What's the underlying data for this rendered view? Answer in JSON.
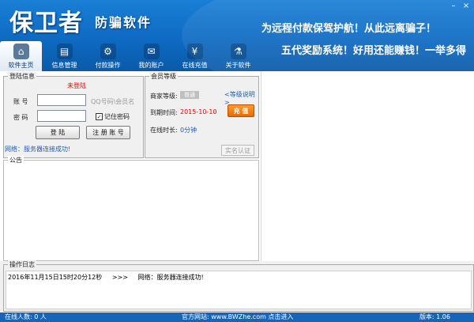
{
  "header": {
    "logo_main": "保卫者",
    "logo_sub": "防骗软件",
    "slogan_1": "为远程付款保驾护航！从此远离骗子！",
    "slogan_2": "五代奖励系统！好用还能赚钱！一举多得",
    "window_buttons": {
      "minimize": "–",
      "close": "×"
    }
  },
  "tabs": [
    {
      "label": "软件主页",
      "icon": "home-icon",
      "glyph": "⌂",
      "active": true
    },
    {
      "label": "信息管理",
      "icon": "document-icon",
      "glyph": "▤",
      "active": false
    },
    {
      "label": "付款操作",
      "icon": "gear-icon",
      "glyph": "⚙",
      "active": false
    },
    {
      "label": "我的账户",
      "icon": "mail-icon",
      "glyph": "✉",
      "active": false
    },
    {
      "label": "在线充值",
      "icon": "yen-icon",
      "glyph": "¥",
      "active": false
    },
    {
      "label": "关于软件",
      "icon": "microscope-icon",
      "glyph": "⚗",
      "active": false
    }
  ],
  "login": {
    "title": "登陆信息",
    "status": "未登陆",
    "account_label": "账 号",
    "password_label": "密 码",
    "account_value": "",
    "password_value": "",
    "account_hint": "QQ号码\\会员名",
    "remember_label": "记住密码",
    "remember_checked": "✓",
    "login_button": "登 陆",
    "register_button": "注 册 账 号",
    "network_status": "网络：服务器连接成功!"
  },
  "member": {
    "title": "会员等级",
    "merchant_label": "商家等级:",
    "merchant_level": "普通",
    "level_link": "<等级说明>",
    "expire_label": "到期时间:",
    "expire_value": "2015-10-10",
    "recharge_button": "充 值",
    "online_label": "在线时长:",
    "online_value": "0分钟",
    "verify_button": "实名认证"
  },
  "notice": {
    "title": "公告"
  },
  "log": {
    "title": "操作日志",
    "entries": [
      {
        "time": "2016年11月15日15时20分12秒",
        "arrow": ">>>",
        "message": "网络：服务器连接成功!"
      }
    ]
  },
  "statusbar": {
    "online_users": "在线人数:  0 人",
    "website": "官方网站: www.BWZhe.com  点击进入",
    "version": "版本:  1.06"
  },
  "colors": {
    "header": "#0e6ac2",
    "status_red": "#ee0000",
    "link_blue": "#1a5fb4",
    "recharge_orange": "#e86b00"
  }
}
